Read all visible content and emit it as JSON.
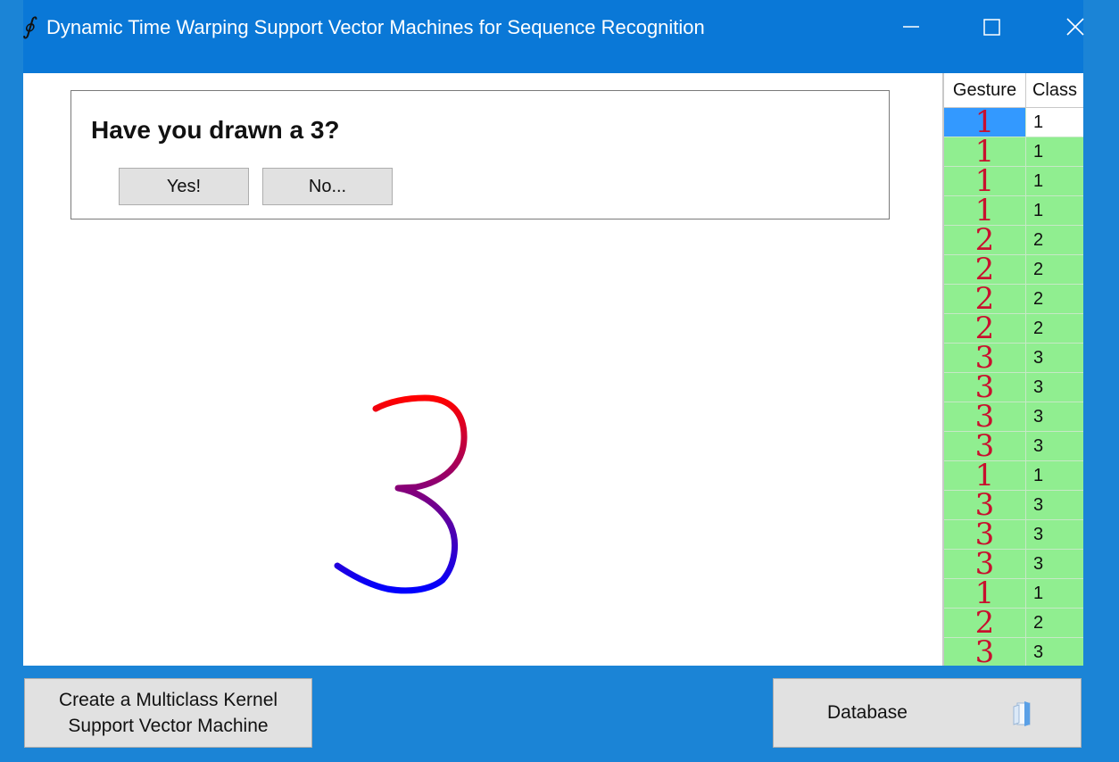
{
  "window": {
    "title": "Dynamic Time Warping Support Vector Machines for Sequence Recognition",
    "icon": "integral-icon"
  },
  "prompt": {
    "question": "Have you drawn a 3?",
    "yes_label": "Yes!",
    "no_label": "No..."
  },
  "drawing": {
    "stroke_start_color": "#ff0000",
    "stroke_end_color": "#0000ff"
  },
  "grid": {
    "headers": {
      "gesture": "Gesture",
      "class": "Class"
    },
    "rows": [
      {
        "gesture": "1",
        "class": "1",
        "selected": true
      },
      {
        "gesture": "1",
        "class": "1"
      },
      {
        "gesture": "1",
        "class": "1"
      },
      {
        "gesture": "1",
        "class": "1"
      },
      {
        "gesture": "2",
        "class": "2"
      },
      {
        "gesture": "2",
        "class": "2"
      },
      {
        "gesture": "2",
        "class": "2"
      },
      {
        "gesture": "2",
        "class": "2"
      },
      {
        "gesture": "3",
        "class": "3"
      },
      {
        "gesture": "3",
        "class": "3"
      },
      {
        "gesture": "3",
        "class": "3"
      },
      {
        "gesture": "3",
        "class": "3"
      },
      {
        "gesture": "1",
        "class": "1"
      },
      {
        "gesture": "3",
        "class": "3"
      },
      {
        "gesture": "3",
        "class": "3"
      },
      {
        "gesture": "3",
        "class": "3"
      },
      {
        "gesture": "1",
        "class": "1"
      },
      {
        "gesture": "2",
        "class": "2"
      },
      {
        "gesture": "3",
        "class": "3"
      }
    ],
    "row_color": "#90ee90",
    "selected_color": "#3399ff",
    "glyph_color": "#c8102e"
  },
  "buttons": {
    "create_line1": "Create a Multiclass Kernel",
    "create_line2": "Support Vector Machine",
    "database": "Database",
    "database_icon": "database-document-icon"
  },
  "colors": {
    "background": "#1b84d6",
    "titlebar": "#0a78d7"
  }
}
